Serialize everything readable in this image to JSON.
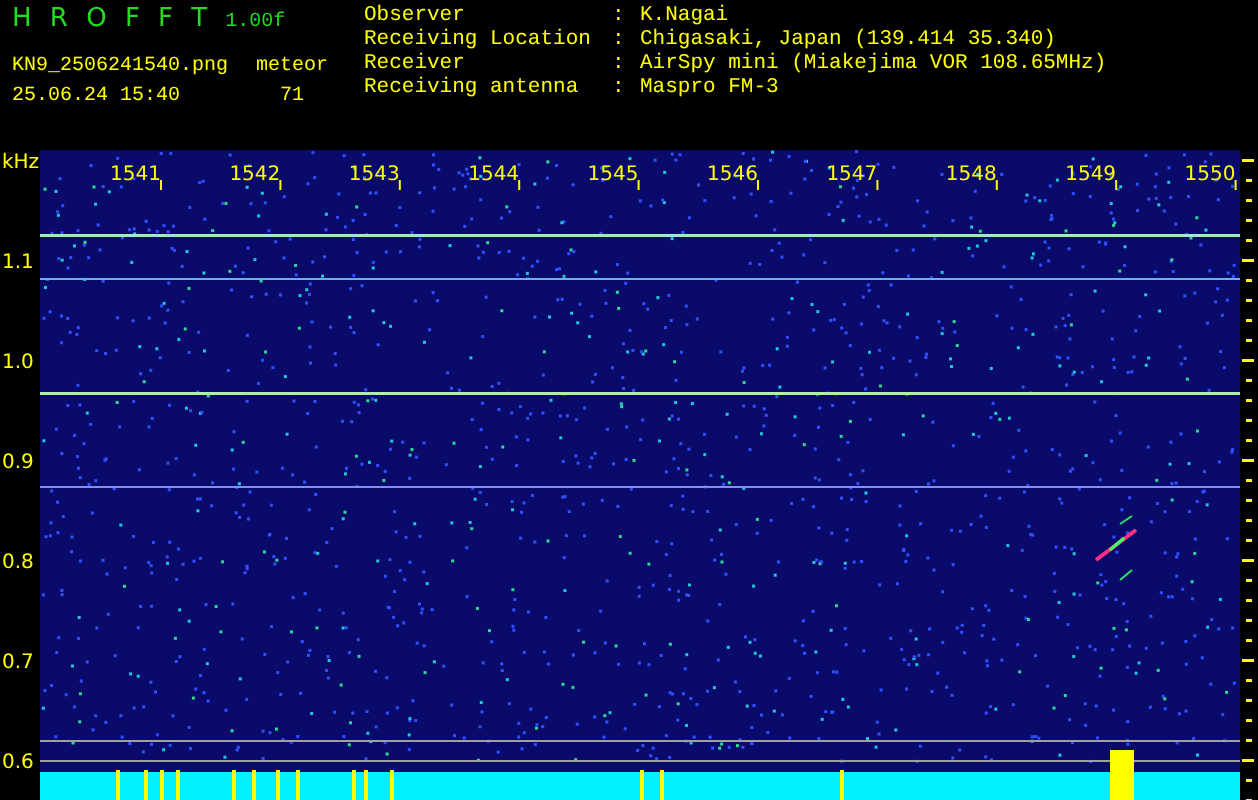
{
  "header": {
    "app_name": "H R O F F T",
    "version": "1.00f",
    "file_name": "KN9_2506241540.png",
    "mode": "meteor",
    "date_time": "25.06.24 15:40",
    "count": "71"
  },
  "info": [
    {
      "label": "Observer",
      "separator": ":",
      "value": "K.Nagai"
    },
    {
      "label": "Receiving Location",
      "separator": ":",
      "value": "Chigasaki, Japan (139.414 35.340)"
    },
    {
      "label": "Receiver",
      "separator": ":",
      "value": "AirSpy mini (Miakejima VOR 108.65MHz)"
    },
    {
      "label": "Receiving antenna",
      "separator": ":",
      "value": "Maspro FM-3"
    }
  ],
  "plot": {
    "y_unit": "kHz",
    "y_labels": [
      "1.1",
      "1.0",
      "0.9",
      "0.8",
      "0.7",
      "0.6"
    ],
    "x_labels": [
      "1541",
      "1542",
      "1543",
      "1544",
      "1545",
      "1546",
      "1547",
      "1548",
      "1549",
      "1550"
    ]
  }
}
